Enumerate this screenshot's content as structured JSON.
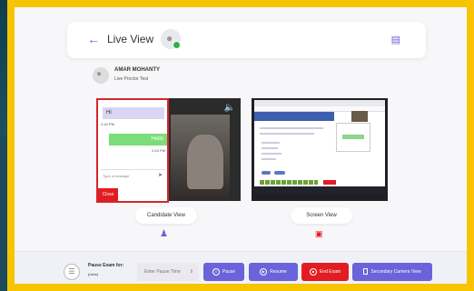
{
  "header": {
    "title": "Live View",
    "back_icon": "arrow-left-icon",
    "book_icon": "book-icon"
  },
  "candidate": {
    "name": "AMAR MOHANTY",
    "subtitle": "Live Proctor Test"
  },
  "chat": {
    "incoming": "Hi",
    "incoming_time": "2:43 PM",
    "outgoing": "Hello",
    "outgoing_time": "2:43 PM",
    "input_placeholder": "Type a message",
    "close_label": "Close"
  },
  "views": {
    "candidate_label": "Candidate View",
    "screen_label": "Screen View"
  },
  "controls": {
    "pause_label": "Pause Exam for:",
    "pause_unit": "(mins)",
    "pause_placeholder": "Enter Pause Time",
    "pause_btn": "Pause",
    "resume_btn": "Resume",
    "end_btn": "End Exam",
    "secondary_btn": "Secondary Camera View"
  },
  "colors": {
    "frame": "#f6c500",
    "accent": "#6a63d9",
    "danger": "#e21d22",
    "online": "#2fb14a"
  }
}
